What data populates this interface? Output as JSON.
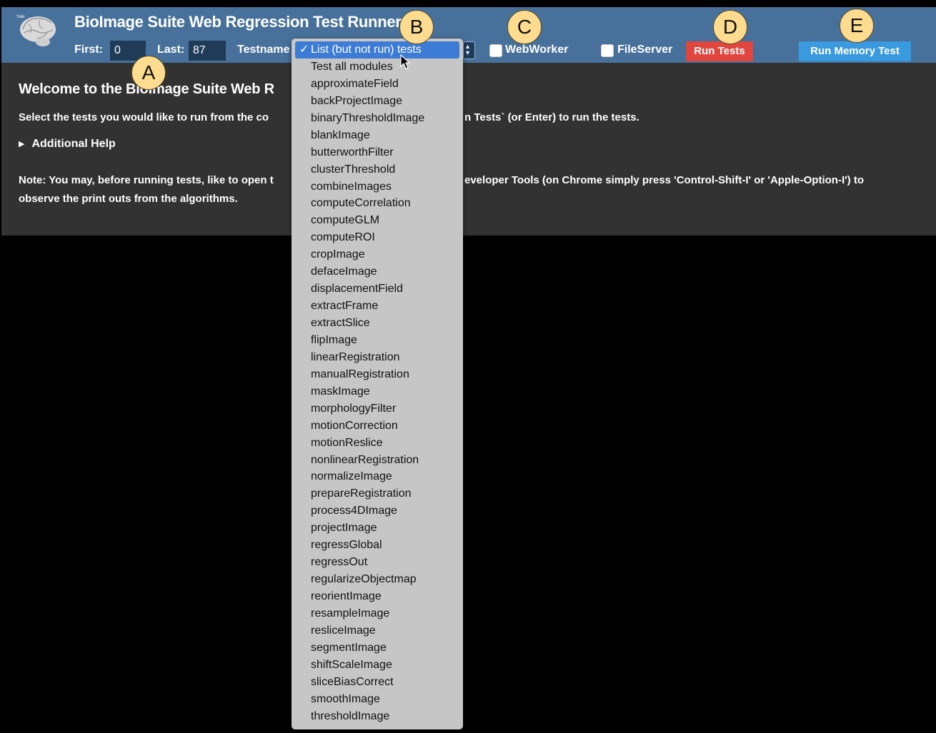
{
  "header": {
    "title": "BioImage Suite Web Regression Test Runner",
    "logo_text": "Yale",
    "first_label": "First:",
    "first_value": "0",
    "last_label": "Last:",
    "last_value": "87",
    "testname_label": "Testname",
    "webworker_label": "WebWorker",
    "fileserver_label": "FileServer",
    "run_tests_label": "Run Tests",
    "run_memory_test_label": "Run Memory Test",
    "colors": {
      "bar": "#47719a",
      "run_tests": "#e0463e",
      "run_memory": "#3a9ae0"
    }
  },
  "content": {
    "heading": "Welcome to the BioImage Suite Web R",
    "intro_left": "Select the tests you would like to run from the co",
    "intro_right": "n Tests` (or Enter) to run the tests.",
    "help_label": "Additional Help",
    "note_bold": "Note:",
    "note_left": " You may, before running tests, like to open t",
    "note_right": "eveloper Tools (on Chrome simply press 'Control-Shift-I' or 'Apple-Option-I') to",
    "note_line2": "observe the print outs from the algorithms."
  },
  "testname_dropdown": {
    "selected_checkmark": "✓",
    "options": [
      "List (but not run) tests",
      "Test all modules",
      "approximateField",
      "backProjectImage",
      "binaryThresholdImage",
      "blankImage",
      "butterworthFilter",
      "clusterThreshold",
      "combineImages",
      "computeCorrelation",
      "computeGLM",
      "computeROI",
      "cropImage",
      "defaceImage",
      "displacementField",
      "extractFrame",
      "extractSlice",
      "flipImage",
      "linearRegistration",
      "manualRegistration",
      "maskImage",
      "morphologyFilter",
      "motionCorrection",
      "motionReslice",
      "nonlinearRegistration",
      "normalizeImage",
      "prepareRegistration",
      "process4DImage",
      "projectImage",
      "regressGlobal",
      "regressOut",
      "regularizeObjectmap",
      "reorientImage",
      "resampleImage",
      "resliceImage",
      "segmentImage",
      "shiftScaleImage",
      "sliceBiasCorrect",
      "smoothImage",
      "thresholdImage"
    ]
  },
  "annotations": {
    "a": "A",
    "b": "B",
    "c": "C",
    "d": "D",
    "e": "E"
  }
}
